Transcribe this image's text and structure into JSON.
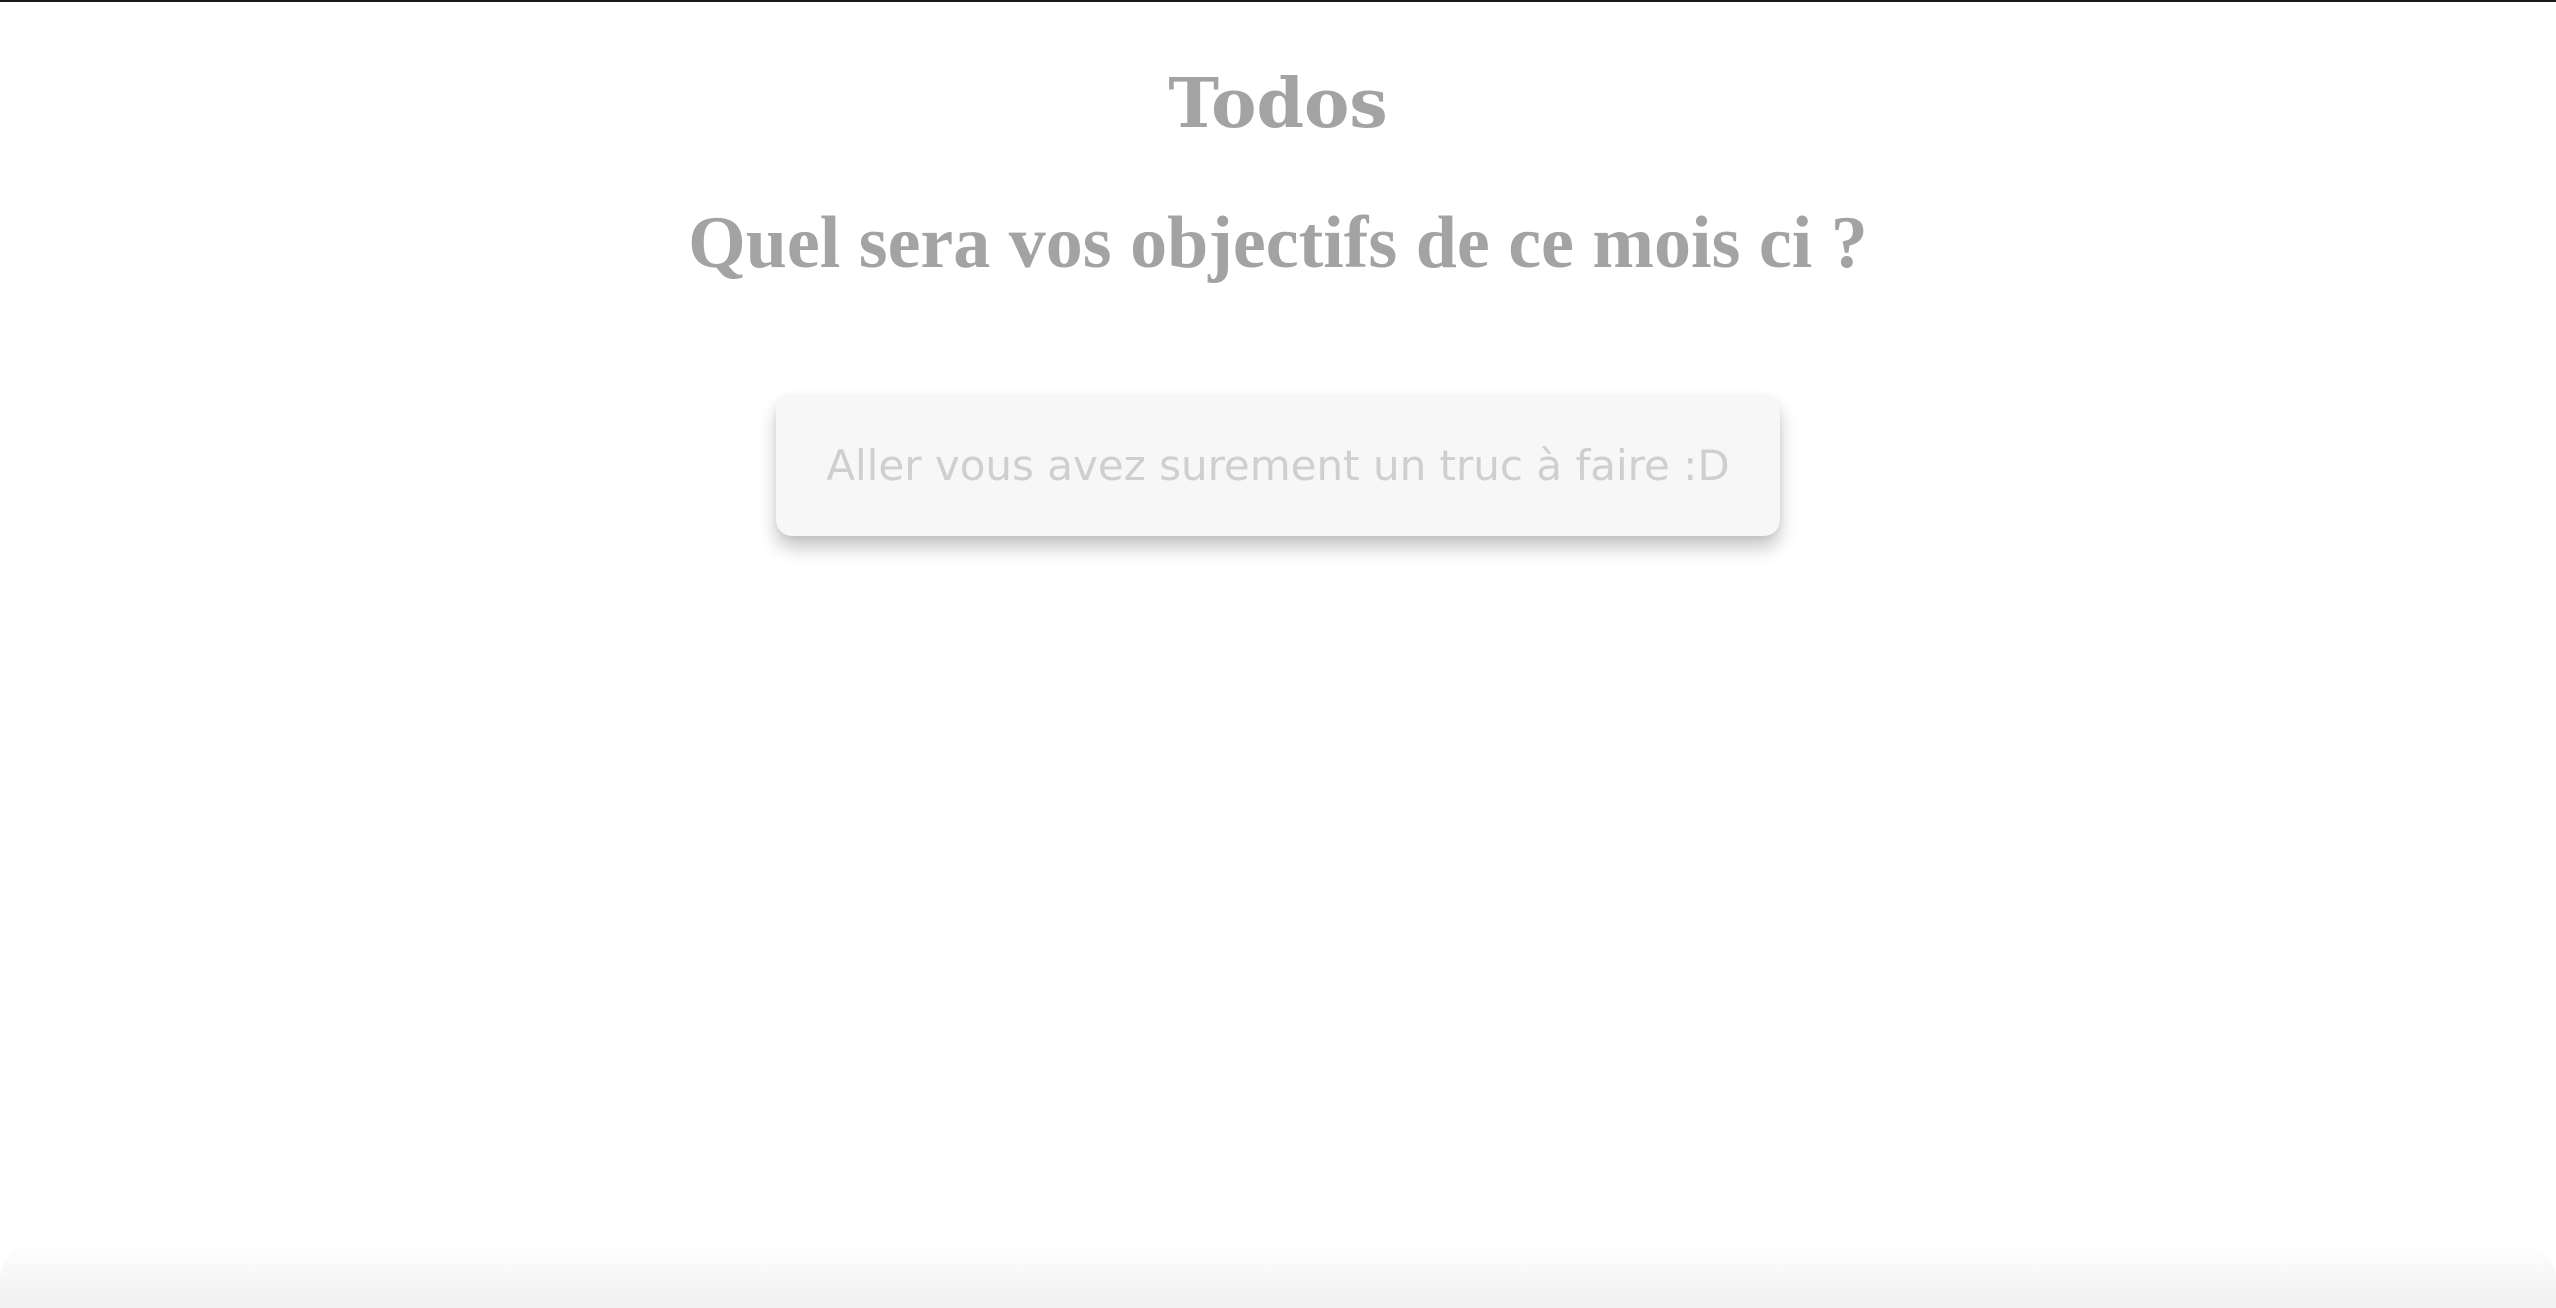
{
  "header": {
    "title": "Todos",
    "subtitle": "Quel sera vos objectifs de ce mois ci ?"
  },
  "todo_input": {
    "value": "",
    "placeholder": "Aller vous avez surement un truc à faire :D"
  },
  "colors": {
    "heading_text": "#a3a3a3",
    "input_background": "#f7f7f7",
    "placeholder_text": "#cfcfcf",
    "page_background": "#ffffff"
  }
}
